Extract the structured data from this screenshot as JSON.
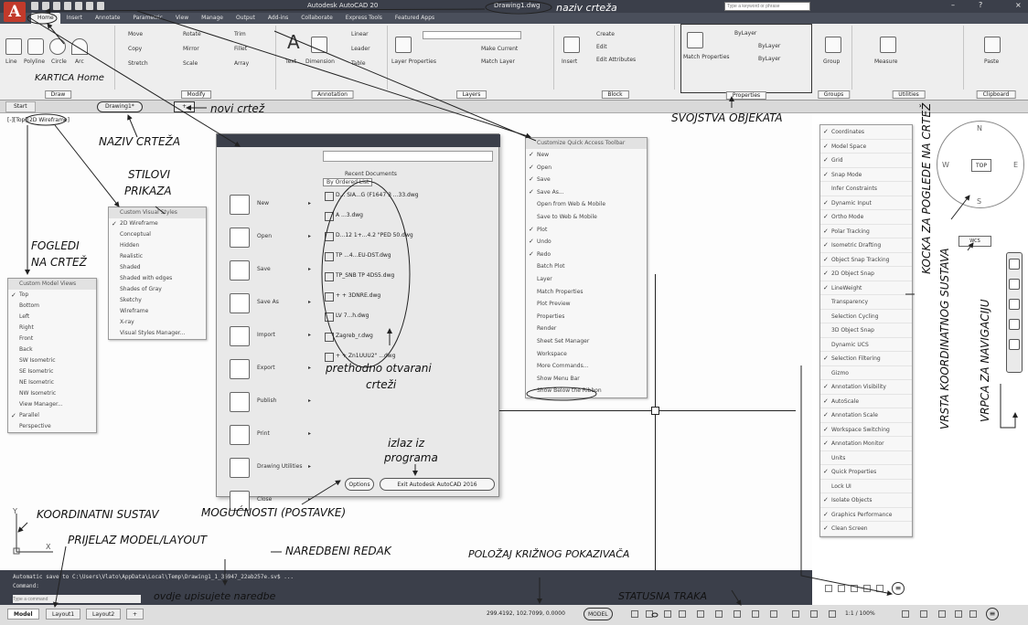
{
  "app": {
    "logo_letter": "A",
    "title": "Autodesk AutoCAD 20",
    "doc_title": "Drawing1.dwg",
    "search_placeholder": "Type a keyword or phrase",
    "ribbon_tabs": [
      "Home",
      "Insert",
      "Annotate",
      "Parametric",
      "View",
      "Manage",
      "Output",
      "Add-ins",
      "Collaborate",
      "Express Tools",
      "Featured Apps"
    ]
  },
  "ribbon": {
    "draw": {
      "items": [
        "Line",
        "Polyline",
        "Circle",
        "Arc"
      ],
      "title": "Draw"
    },
    "modify": {
      "items": [
        "Move",
        "Rotate",
        "Trim",
        "Copy",
        "Mirror",
        "Fillet",
        "Stretch",
        "Scale",
        "Array"
      ],
      "title": "Modify"
    },
    "annotation": {
      "items": [
        "Text",
        "Dimension",
        "Linear",
        "Leader",
        "Table"
      ],
      "title": "Annotation"
    },
    "layers": {
      "items": [
        "Layer Properties",
        "Make Current",
        "Match Layer"
      ],
      "title": "Layers"
    },
    "block": {
      "items": [
        "Insert",
        "Create",
        "Edit",
        "Edit Attributes"
      ],
      "title": "Block"
    },
    "properties": {
      "items": [
        "Match Properties",
        "ByLayer",
        "ByLayer",
        "ByLayer"
      ],
      "title": "Properties"
    },
    "groups": {
      "items": [
        "Group"
      ],
      "title": "Groups"
    },
    "utilities": {
      "items": [
        "Measure"
      ],
      "title": "Utilities"
    },
    "clipboard": {
      "items": [
        "Paste"
      ],
      "title": "Clipboard"
    }
  },
  "file_tabs": [
    "Start",
    "Drawing1*"
  ],
  "viewport_label": "[-][Top][2D Wireframe]",
  "visual_styles_menu": {
    "header": "Custom Visual Styles",
    "items": [
      "2D Wireframe",
      "Conceptual",
      "Hidden",
      "Realistic",
      "Shaded",
      "Shaded with edges",
      "Shades of Gray",
      "Sketchy",
      "Wireframe",
      "X-ray",
      "Visual Styles Manager..."
    ],
    "checked": [
      true,
      false,
      false,
      false,
      false,
      false,
      false,
      false,
      false,
      false,
      false
    ]
  },
  "views_menu": {
    "header": "Custom Model Views",
    "items": [
      "Top",
      "Bottom",
      "Left",
      "Right",
      "Front",
      "Back",
      "SW Isometric",
      "SE Isometric",
      "NE Isometric",
      "NW Isometric",
      "View Manager...",
      "Parallel",
      "Perspective"
    ],
    "checked": [
      true,
      false,
      false,
      false,
      false,
      false,
      false,
      false,
      false,
      false,
      false,
      true,
      false
    ]
  },
  "app_menu": {
    "search_placeholder": "",
    "recent_title": "Recent Documents",
    "sort_label": "By Ordered List",
    "left_items": [
      "New",
      "Open",
      "Save",
      "Save As",
      "Import",
      "Export",
      "Publish",
      "Print",
      "Drawing Utilities",
      "Close"
    ],
    "recent_files": [
      "D... SIA...G (F1647 3 ...33.dwg",
      "A ...3.dwg",
      "D...12 1+...4.2 \"PED 50.dwg",
      "TP ...4...EU-DST.dwg",
      "TP_SNB TP 4DS5.dwg",
      "+ + 3DNRE.dwg",
      "LV 7...h.dwg",
      "Zagreb_r.dwg",
      "+ + Zn1UUU2\" ...dwg"
    ],
    "options_label": "Options",
    "exit_label": "Exit Autodesk AutoCAD 2016"
  },
  "qat_menu": {
    "title": "Customize Quick Access Toolbar",
    "items": [
      "New",
      "Open",
      "Save",
      "Save As...",
      "Open from Web & Mobile",
      "Save to Web & Mobile",
      "Plot",
      "Undo",
      "Redo",
      "Batch Plot",
      "Layer",
      "Match Properties",
      "Plot Preview",
      "Properties",
      "Render",
      "Sheet Set Manager",
      "Workspace",
      "More Commands...",
      "Show Menu Bar",
      "Show Below the Ribbon"
    ],
    "checked": [
      true,
      true,
      true,
      true,
      false,
      false,
      true,
      true,
      true,
      false,
      false,
      false,
      false,
      false,
      false,
      false,
      false,
      false,
      false,
      false
    ]
  },
  "status_customize_menu": {
    "items": [
      "Coordinates",
      "Model Space",
      "Grid",
      "Snap Mode",
      "Infer Constraints",
      "Dynamic Input",
      "Ortho Mode",
      "Polar Tracking",
      "Isometric Drafting",
      "Object Snap Tracking",
      "2D Object Snap",
      "LineWeight",
      "Transparency",
      "Selection Cycling",
      "3D Object Snap",
      "Dynamic UCS",
      "Selection Filtering",
      "Gizmo",
      "Annotation Visibility",
      "AutoScale",
      "Annotation Scale",
      "Workspace Switching",
      "Annotation Monitor",
      "Units",
      "Quick Properties",
      "Lock UI",
      "Isolate Objects",
      "Graphics Performance",
      "Clean Screen"
    ],
    "checked": [
      true,
      true,
      true,
      true,
      false,
      true,
      true,
      true,
      true,
      true,
      true,
      true,
      false,
      false,
      false,
      false,
      true,
      false,
      true,
      true,
      true,
      true,
      true,
      false,
      true,
      false,
      true,
      true,
      true
    ]
  },
  "viewcube": {
    "top": "TOP",
    "n": "N",
    "s": "S",
    "w": "W",
    "e": "E",
    "wcs": "WCS"
  },
  "command_line": {
    "line1": "Automatic save to C:\\Users\\Vlato\\AppData\\Local\\Temp\\Drawing1_1_36947_22ab257e.sv$ ...",
    "line2": "Command:",
    "placeholder": "Type a command"
  },
  "layout_tabs": [
    "Model",
    "Layout1",
    "Layout2",
    "+"
  ],
  "status_bar": {
    "coords": "299.4192, 102.7099, 0.0000",
    "model": "MODEL",
    "scale": "1:1 / 100%"
  },
  "annotations": {
    "naziv_crteza_top": "naziv crteža",
    "kartica_home": "KARTICA Home",
    "novi_crtez": "novi crtež",
    "naziv_crteza": "NAZIV CRTEŽA",
    "stilovi": "STILOVI",
    "prikaza": "PRIKAZA",
    "fogledi": "FOGLEDI",
    "na_crtez": "NA CRTEŽ",
    "svojstva": "SVOJSTVA OBJEKATA",
    "prethodno": "prethodno otvarani",
    "crtezi": "crteži",
    "izlaz": "izlaz iz",
    "programa": "programa",
    "mogucnosti": "MOGUĆNOSTI (POSTAVKE)",
    "koordinatni": "KOORDINATNI SUSTAV",
    "prijelaz": "PRIJELAZ MODEL/LAYOUT",
    "naredbeni": "NAREDBENI REDAK",
    "polozaj": "POLOŽAJ KRIŽNOG POKAZIVAČA",
    "ovdje": "ovdje upisujete naredbe",
    "statusna": "STATUSNA TRAKA",
    "kocka": "KOCKA ZA POGLEDE NA CRTEŽ",
    "vrsta": "VRSTA KOORDINATNOG SUSTAVA",
    "vrpca": "VRPCA ZA NAVIGACIJU"
  }
}
